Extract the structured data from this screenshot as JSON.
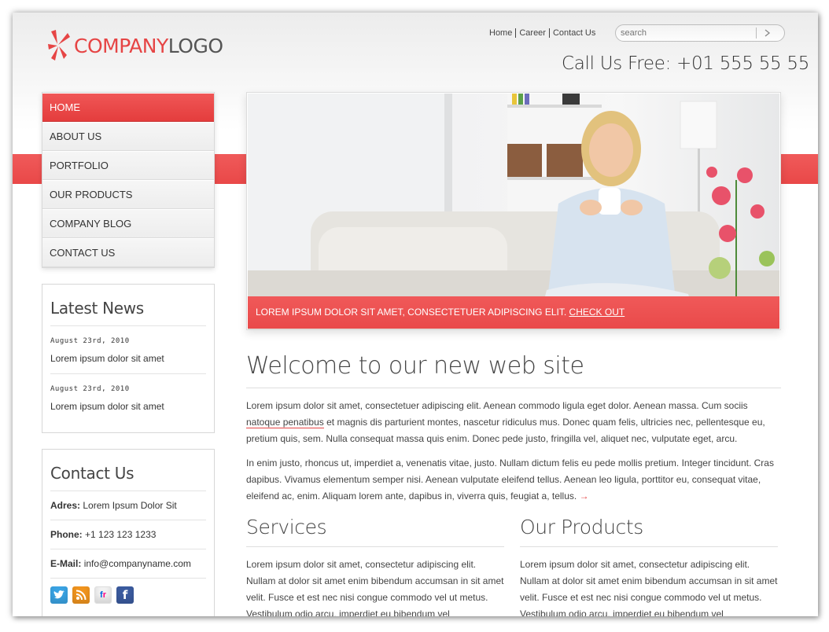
{
  "header": {
    "logo": {
      "part1": "COMPANY",
      "part2": "LOGO"
    },
    "top_links": [
      "Home",
      "Career",
      "Contact Us"
    ],
    "search": {
      "placeholder": "search",
      "button_icon": "arrow-right-icon"
    },
    "phone": "Call Us Free: +01 555 55 55"
  },
  "nav": {
    "items": [
      {
        "label": "HOME",
        "active": true
      },
      {
        "label": "ABOUT US",
        "active": false
      },
      {
        "label": "PORTFOLIO",
        "active": false
      },
      {
        "label": "OUR PRODUCTS",
        "active": false
      },
      {
        "label": "COMPANY BLOG",
        "active": false
      },
      {
        "label": "CONTACT US",
        "active": false
      }
    ]
  },
  "latest_news": {
    "title": "Latest News",
    "items": [
      {
        "date": "August 23rd, 2010",
        "text": "Lorem ipsum dolor sit amet"
      },
      {
        "date": "August 23rd, 2010",
        "text": "Lorem ipsum dolor sit amet"
      }
    ]
  },
  "contact": {
    "title": "Contact Us",
    "address_label": "Adres:",
    "address": "Lorem Ipsum Dolor Sit",
    "phone_label": "Phone:",
    "phone": "+1 123 123 1233",
    "email_label": "E-Mail:",
    "email": "info@companyname.com",
    "social": [
      {
        "name": "twitter-icon",
        "glyph": "t",
        "color": "#3aa3e3"
      },
      {
        "name": "rss-icon",
        "glyph": "⌇",
        "color": "#f0941e"
      },
      {
        "name": "flickr-icon",
        "glyph": "fr",
        "color": "#f2f2f2"
      },
      {
        "name": "facebook-icon",
        "glyph": "f",
        "color": "#3b5b9f"
      }
    ]
  },
  "hero": {
    "caption": "LOREM IPSUM DOLOR SIT AMET, CONSECTETUER ADIPISCING ELIT.",
    "link": "CHECK OUT"
  },
  "welcome": {
    "title": "Welcome to our new web site",
    "p1_a": "Lorem ipsum dolor sit amet, consectetuer adipiscing elit. Aenean commodo ligula eget dolor. Aenean massa. Cum sociis",
    "p1_highlight": "natoque penatibus",
    "p1_b": "et magnis dis parturient montes, nascetur ridiculus mus. Donec quam felis, ultricies nec, pellentesque eu, pretium quis, sem. Nulla consequat massa quis enim. Donec pede justo, fringilla vel, aliquet nec, vulputate eget, arcu.",
    "p2": "In enim justo, rhoncus ut, imperdiet a, venenatis vitae, justo. Nullam dictum felis eu pede mollis pretium. Integer tincidunt. Cras dapibus. Vivamus elementum semper nisi. Aenean vulputate eleifend tellus. Aenean leo ligula, porttitor eu, consequat vitae, eleifend ac, enim. Aliquam lorem ante, dapibus in, viverra quis, feugiat a, tellus.",
    "p2_arrow": "→"
  },
  "services": {
    "title": "Services",
    "text": "Lorem ipsum dolor sit amet, consectetur adipiscing elit. Nullam at dolor sit amet enim bibendum accumsan in sit amet velit. Fusce et est nec nisi congue commodo vel ut metus. Vestibulum odio arcu, imperdiet eu bibendum vel"
  },
  "products": {
    "title": "Our Products",
    "text": "Lorem ipsum dolor sit amet, consectetur adipiscing elit. Nullam at dolor sit amet enim bibendum accumsan in sit amet velit. Fusce et est nec nisi congue commodo vel ut metus. Vestibulum odio arcu, imperdiet eu bibendum vel"
  },
  "colors": {
    "accent": "#e94848",
    "text": "#444444"
  }
}
